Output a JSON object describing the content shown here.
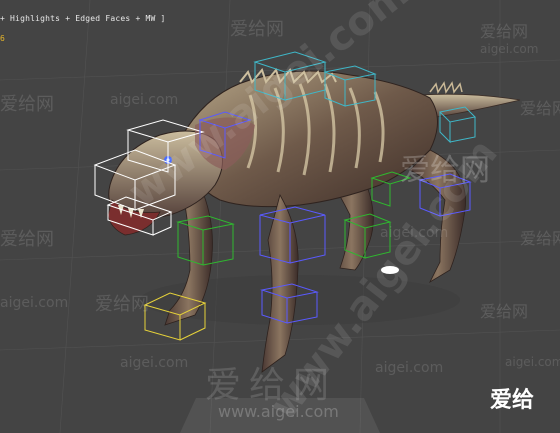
{
  "viewport": {
    "label": "+ Highlights + Edged Faces + MW ]",
    "counter": "6"
  },
  "watermarks": {
    "cn_brand": "爱给网",
    "url": "aigei.com",
    "url_full": "www.aigei.com",
    "diagonal": "www.aigei.com",
    "corner_brand": "爱给"
  },
  "colors": {
    "background": "#444444",
    "grid": "#555555",
    "counter": "#e8b72a",
    "bbox_white": "#ffffff",
    "bbox_blue": "#5a5aff",
    "bbox_green": "#2fb82f",
    "bbox_cyan": "#3fb7c8",
    "bbox_yellow": "#e6d23a"
  }
}
